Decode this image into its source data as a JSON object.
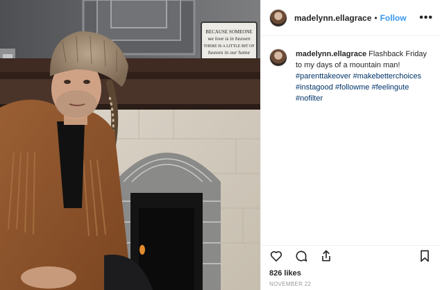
{
  "header": {
    "username": "madelynn.ellagrace",
    "separator": "•",
    "follow_label": "Follow",
    "more_label": "•••"
  },
  "sign": {
    "line1": "BECAUSE SOMEONE",
    "line2": "we love is in heaven",
    "line3": "THERE IS A LITTLE BIT OF",
    "line4": "heaven in our home"
  },
  "caption": {
    "username": "madelynn.ellagrace",
    "text": "Flashback Friday to my days of a mountain man!",
    "hashtags": [
      "#parenttakeover",
      "#makebetterchoices",
      "#instagood",
      "#followme",
      "#feelingute",
      "#nofilter"
    ]
  },
  "actions": {
    "like_icon": "heart-icon",
    "comment_icon": "comment-icon",
    "share_icon": "share-icon",
    "save_icon": "bookmark-icon"
  },
  "likes_text": "826 likes",
  "date_text": "NOVEMBER 22",
  "colors": {
    "follow": "#3897f0",
    "hashtag": "#003569",
    "border": "#efefef",
    "muted": "#999999"
  }
}
